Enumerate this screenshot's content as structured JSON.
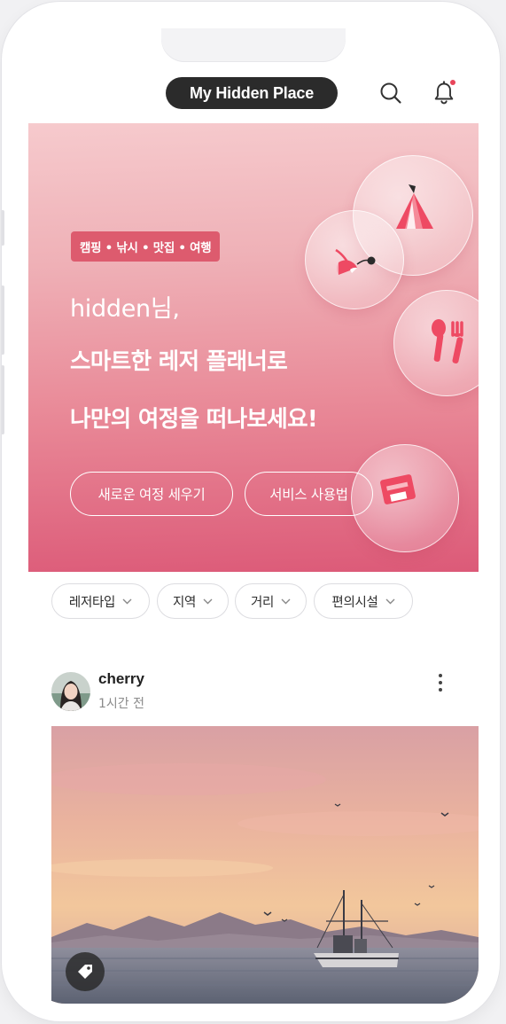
{
  "header": {
    "title": "My Hidden Place",
    "search_icon": "search-icon",
    "bell_icon": "bell-icon",
    "has_notification": true
  },
  "hero": {
    "tags": "캠핑 • 낚시 • 맛집 • 여행",
    "greeting": "hidden님,",
    "headline_line1": "스마트한 레저 플래너로",
    "headline_line2": "나만의 여정을 떠나보세요!",
    "new_trip_button": "새로운 여정 세우기",
    "how_to_button": "서비스 사용법",
    "bubble_icons": [
      "tent-icon",
      "fishing-float-icon",
      "fork-spoon-icon",
      "ticket-icon"
    ]
  },
  "filters": [
    {
      "label": "레저타입"
    },
    {
      "label": "지역"
    },
    {
      "label": "거리"
    },
    {
      "label": "편의시설"
    }
  ],
  "post": {
    "username": "cherry",
    "time": "1시간 전",
    "menu_icon": "more-vertical-icon",
    "photo_alt": "sunset sea with fishing boat and mountains",
    "tag_icon": "tag-icon"
  },
  "colors": {
    "accent": "#dd5b6e",
    "header_pill": "#2b2b2b",
    "notification_dot": "#e8455a"
  }
}
